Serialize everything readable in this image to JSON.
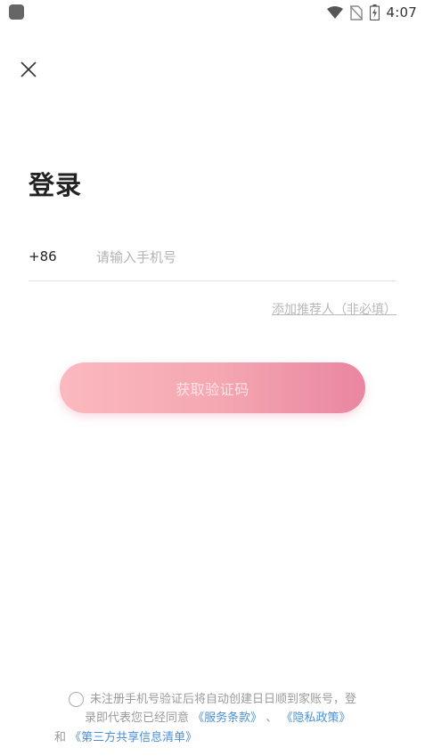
{
  "status_bar": {
    "time": "4:07",
    "icons": [
      "app-icon",
      "wifi-icon",
      "no-sim-icon",
      "battery-charging-icon"
    ]
  },
  "header": {
    "close_icon": "close-icon"
  },
  "login": {
    "title": "登录",
    "country_code": "+86",
    "phone_placeholder": "请输入手机号",
    "phone_value": "",
    "referrer_link": "添加推荐人（非必填）",
    "get_code_button": "获取验证码"
  },
  "agreement": {
    "checked": false,
    "line1": "未注册手机号验证后将自动创建日日顺到家账号，登",
    "line2_prefix": "录即代表您已经同意",
    "service_terms": "《服务条款》",
    "separator": "、",
    "privacy_policy": "《隐私政策》",
    "and": "和",
    "third_party_list": "《第三方共享信息清单》"
  },
  "colors": {
    "button_gradient_start": "#fbb9bf",
    "button_gradient_end": "#e986a0",
    "link": "#4a90d9",
    "placeholder": "#b3b3b3"
  }
}
